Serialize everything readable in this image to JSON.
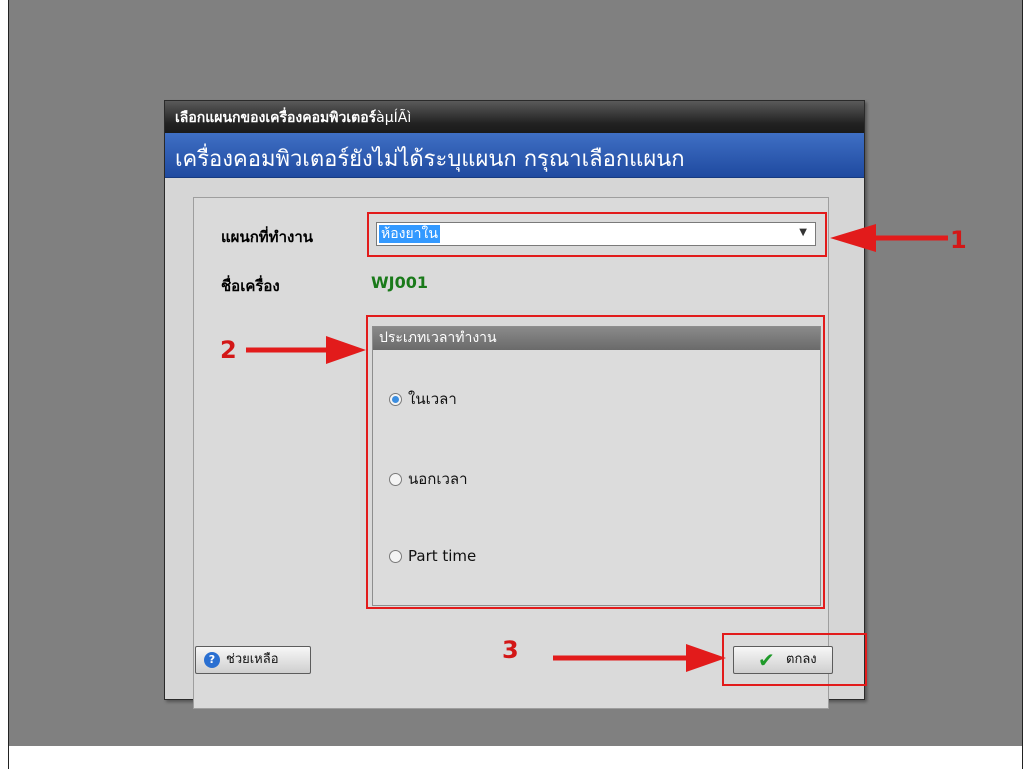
{
  "window": {
    "title": "เลือกแผนกของเครื่องคอมพิวเตอร์",
    "title_extra": "àµÍÃì",
    "banner": "เครื่องคอมพิวเตอร์ยังไม่ได้ระบุแผนก กรุณาเลือกแผนก"
  },
  "form": {
    "department_label": "แผนกที่ทำงาน",
    "department_value": "ห้องยาใน",
    "machine_label": "ชื่อเครื่อง",
    "machine_value": "WJ001"
  },
  "work_time_group": {
    "title": "ประเภทเวลาทำงาน",
    "options": [
      {
        "label": "ในเวลา",
        "selected": true
      },
      {
        "label": "นอกเวลา",
        "selected": false
      },
      {
        "label": "Part time",
        "selected": false
      }
    ]
  },
  "buttons": {
    "help_label": "ช่วยเหลือ",
    "help_icon": "?",
    "ok_label": "ตกลง",
    "ok_icon": "✔"
  },
  "annotations": {
    "markers": [
      "1",
      "2",
      "3"
    ],
    "color": "#e21b1b"
  }
}
